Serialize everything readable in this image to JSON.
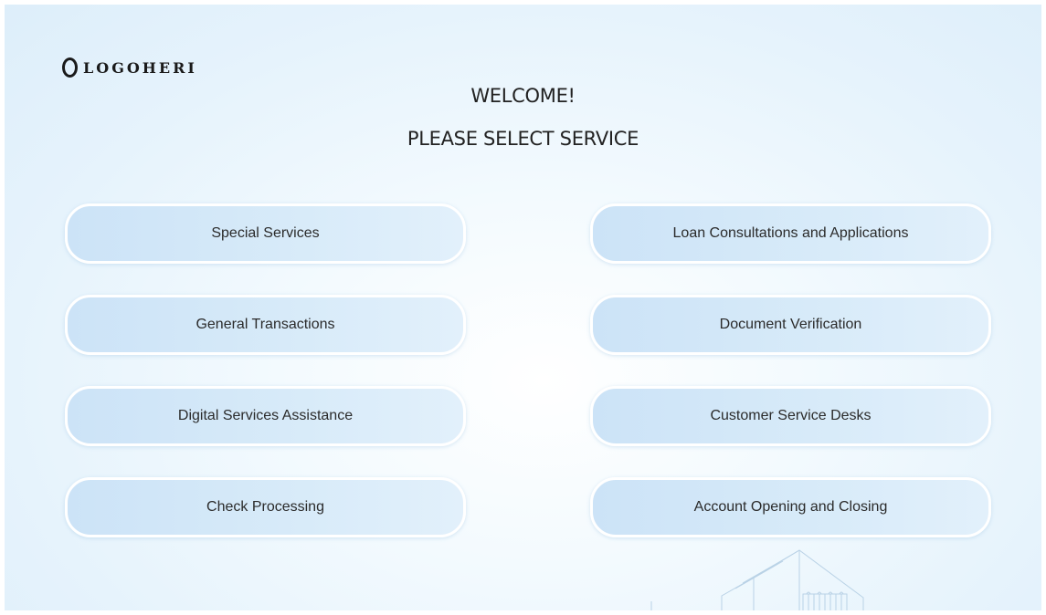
{
  "header": {
    "logo_text": "LOGOHERI",
    "welcome": "WELCOME!",
    "prompt": "PLEASE SELECT SERVICE"
  },
  "services": {
    "left": [
      "Special Services",
      "General Transactions",
      "Digital Services Assistance",
      "Check Processing"
    ],
    "right": [
      "Loan Consultations and Applications",
      "Document Verification",
      "Customer Service Desks",
      "Account Opening and Closing"
    ]
  },
  "colors": {
    "button_fill": "#cce3f7",
    "button_border": "#ffffff",
    "background": "#e6f3fc",
    "text": "#222222"
  },
  "icons": {
    "logo": "circle-logo-icon",
    "background_art": "building-illustration-icon"
  }
}
